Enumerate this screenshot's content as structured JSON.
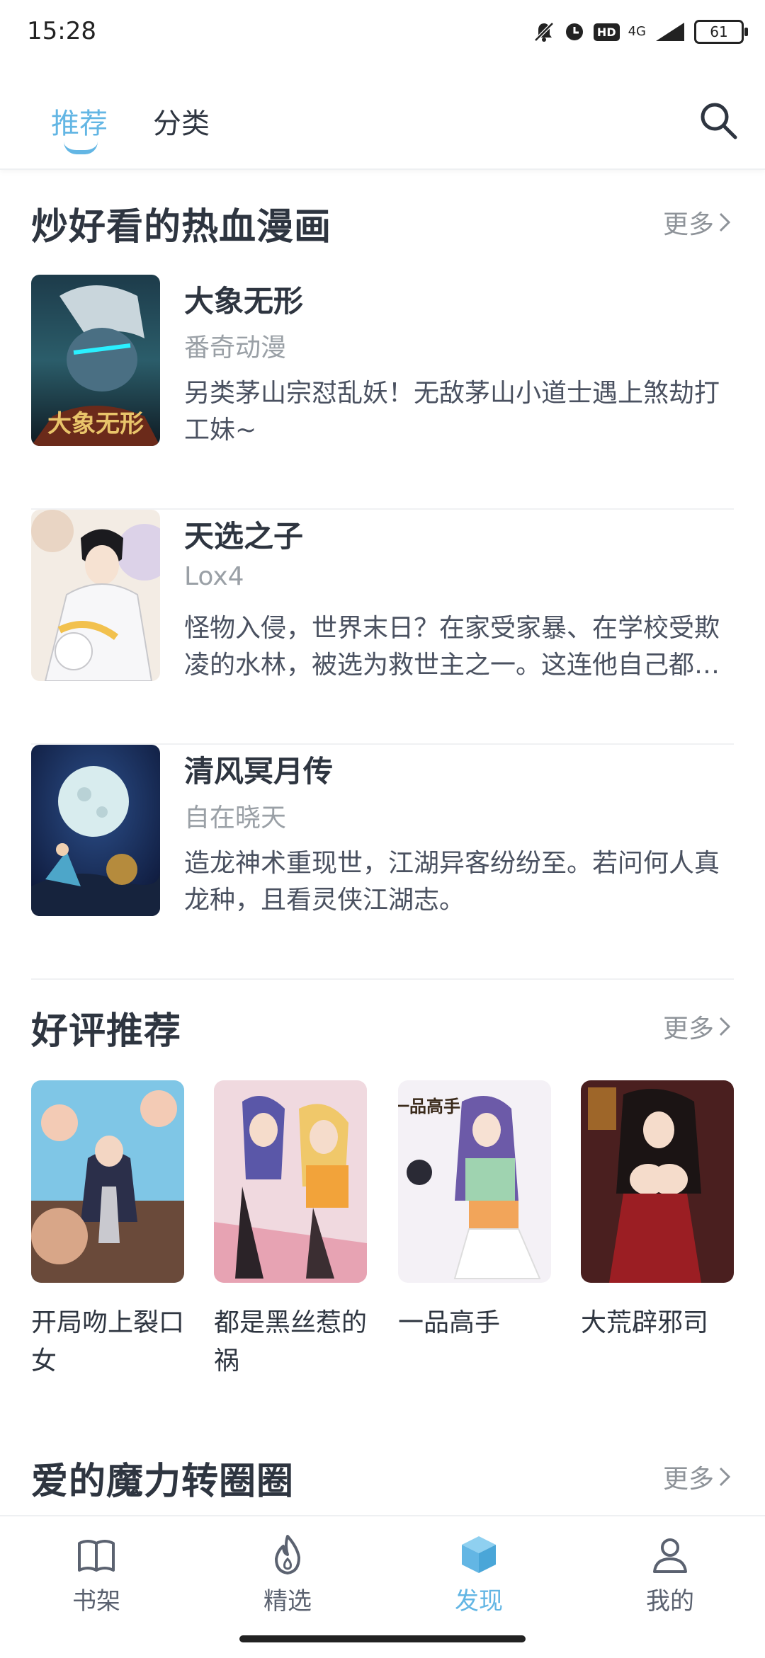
{
  "status": {
    "time": "15:28",
    "network": "4G",
    "hd": "HD",
    "battery": "61"
  },
  "header": {
    "tabs": [
      "推荐",
      "分类"
    ],
    "active_tab": "推荐"
  },
  "sections": {
    "hot": {
      "title": "炒好看的热血漫画",
      "more": "更多",
      "items": [
        {
          "title": "大象无形",
          "author": "番奇动漫",
          "desc": "另类茅山宗怼乱妖！无敌茅山小道士遇上煞劫打工妹~",
          "cover_text": "大象无形"
        },
        {
          "title": "天选之子",
          "author": "Lox4",
          "desc": "怪物入侵，世界末日？在家受家暴、在学校受欺凌的水林，被选为救世主之一。这连他自己都没想到……"
        },
        {
          "title": "清风冥月传",
          "author": "自在晓天",
          "desc": "造龙神术重现世，江湖异客纷纷至。若问何人真龙种，且看灵侠江湖志。"
        }
      ]
    },
    "good": {
      "title": "好评推荐",
      "more": "更多",
      "items": [
        {
          "title": "开局吻上裂口女"
        },
        {
          "title": "都是黑丝惹的祸"
        },
        {
          "title": "一品高手",
          "cover_text": "一品高手"
        },
        {
          "title": "大荒辟邪司"
        }
      ]
    },
    "love": {
      "title": "爱的魔力转圈圈",
      "more": "更多"
    }
  },
  "nav": [
    {
      "label": "书架",
      "icon": "book-icon"
    },
    {
      "label": "精选",
      "icon": "flame-icon"
    },
    {
      "label": "发现",
      "icon": "cube-icon",
      "active": true
    },
    {
      "label": "我的",
      "icon": "person-icon"
    }
  ],
  "colors": {
    "accent": "#63b6e4",
    "text": "#2e3540",
    "muted": "#9aa0a6"
  }
}
